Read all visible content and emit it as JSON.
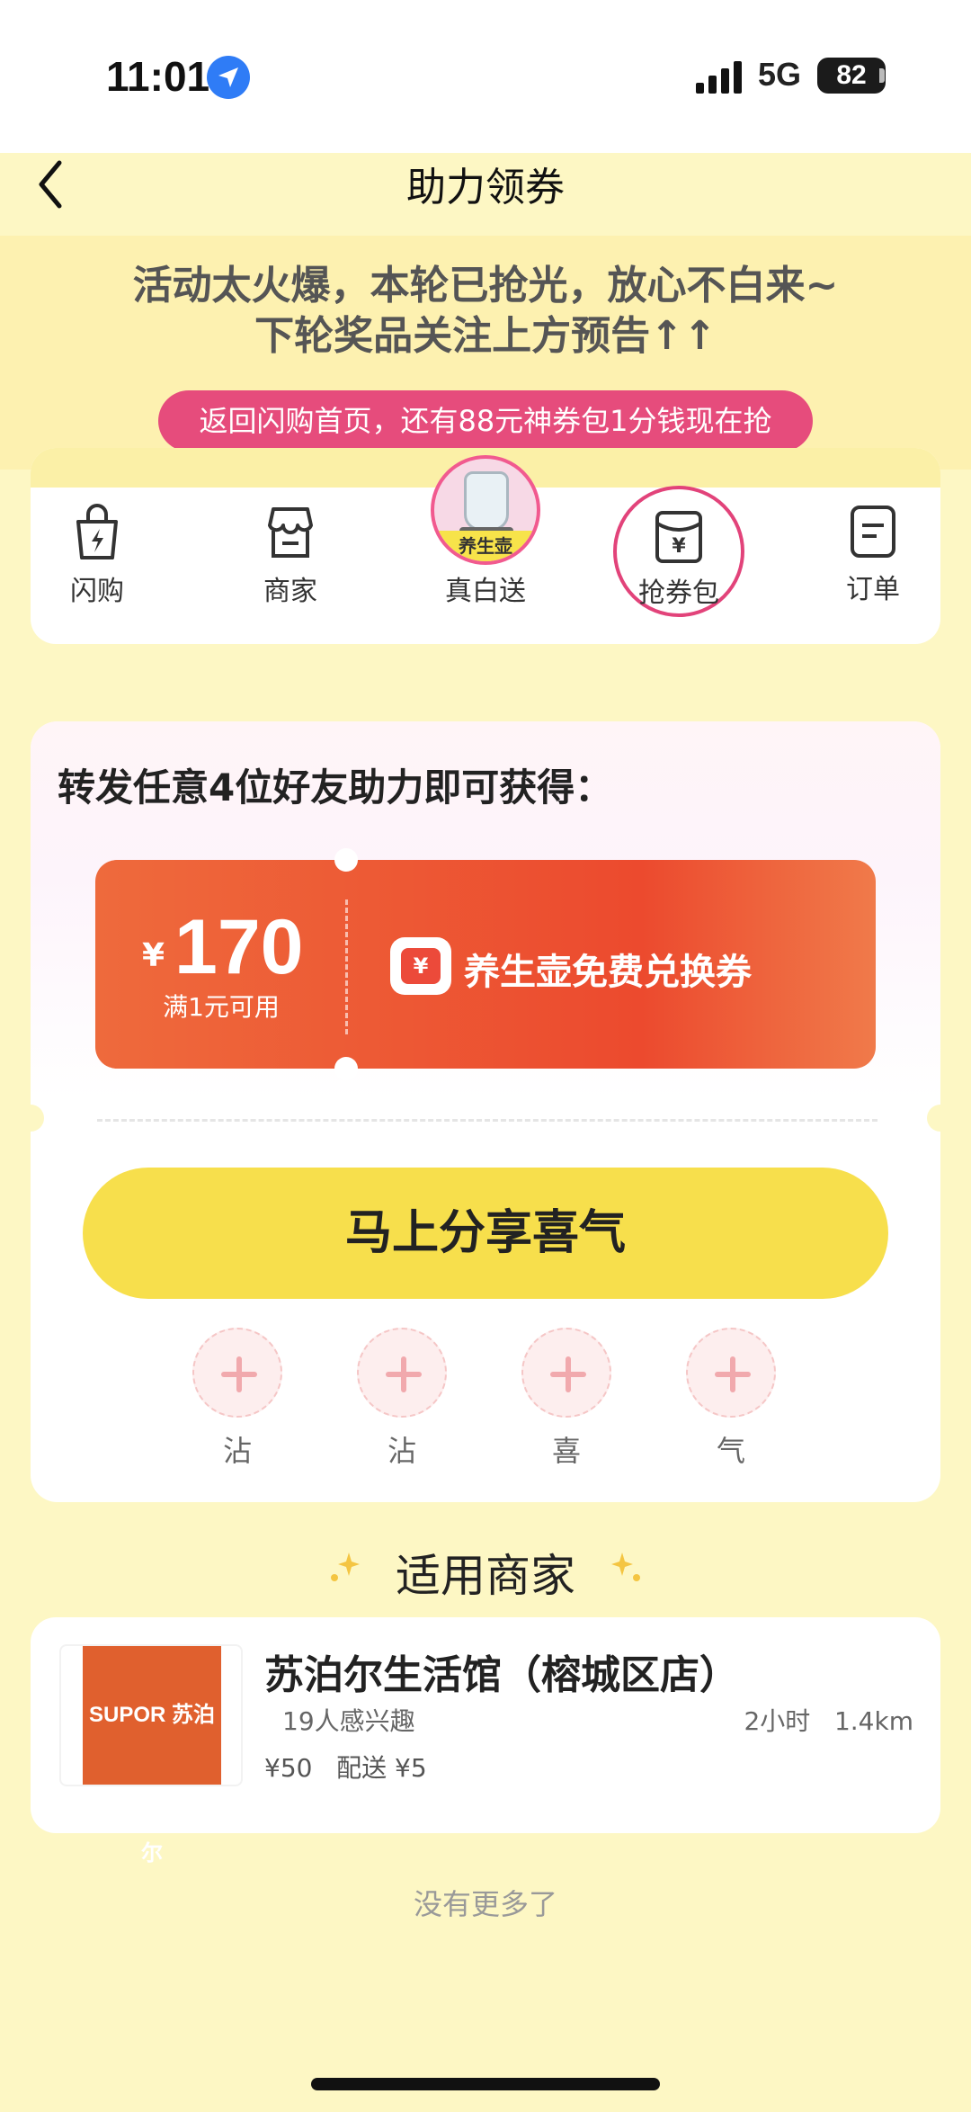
{
  "status_bar": {
    "time": "11:01",
    "network": "5G",
    "battery": "82"
  },
  "nav": {
    "title": "助力领券"
  },
  "notice": {
    "line1": "活动太火爆，本轮已抢光，放心不白来~",
    "line2": "下轮奖品关注上方预告↑↑"
  },
  "banner": {
    "text": "返回闪购首页，还有88元神券包1分钱现在抢"
  },
  "tabs": {
    "flash": "闪购",
    "shop": "商家",
    "free_tag": "养生壶",
    "free": "真白送",
    "coupon": "抢券包",
    "order": "订单"
  },
  "invite": {
    "title": "转发任意4位好友助力即可获得："
  },
  "coupon": {
    "currency": "¥",
    "amount": "170",
    "condition": "满1元可用",
    "name": "养生壶免费兑换券",
    "icon": "¥"
  },
  "share_button": {
    "label": "马上分享喜气"
  },
  "helpers": [
    "沾",
    "沾",
    "喜",
    "气"
  ],
  "merchants_section": {
    "title": "适用商家"
  },
  "merchant": {
    "logo_text": "SUPOR 苏泊尔",
    "name": "苏泊尔生活馆（榕城区店）",
    "interest": "19人感兴趣",
    "distance": "2小时   1.4km",
    "fees": "¥50   配送 ¥5"
  },
  "footer": {
    "no_more": "没有更多了"
  },
  "colors": {
    "background": "#fdf7c4",
    "accent_pink": "#e64c7c",
    "coupon_red": "#ec4a2e",
    "button_yellow": "#f7df4c"
  }
}
